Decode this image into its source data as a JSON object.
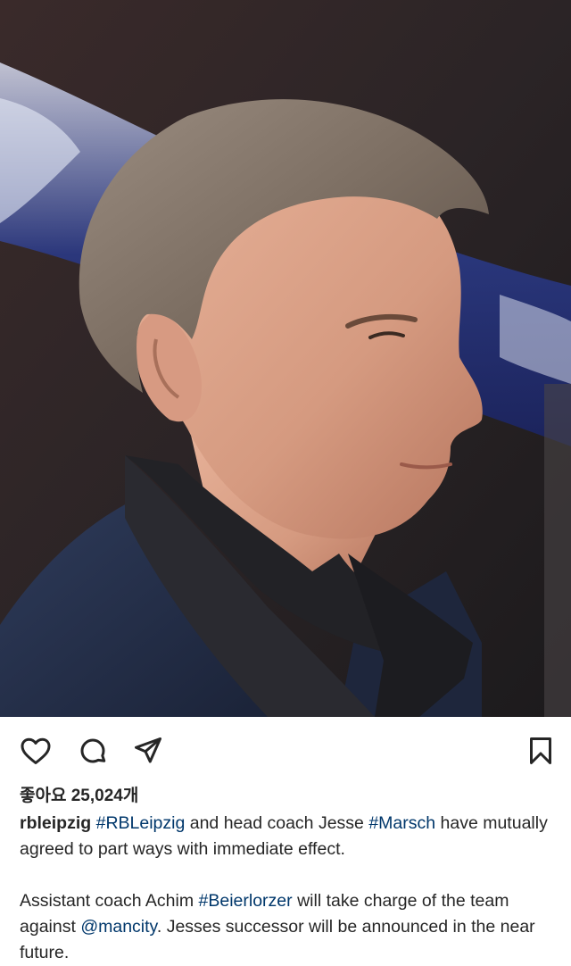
{
  "post": {
    "likes_label": "좋아요",
    "likes_count": "25,024",
    "likes_suffix": "개",
    "username": "rbleipzig",
    "caption": {
      "p1": {
        "t1": "#RBLeipzig",
        "t2": " and head coach Jesse ",
        "t3": "#Marsch",
        "t4": " have mutually agreed to part ways with immediate effect."
      },
      "p2": {
        "t1": "Assistant coach Achim ",
        "t2": "#Beierlorzer",
        "t3": " will take charge of the team against ",
        "t4": "@mancity",
        "t5": ". Jesses successor will be announced in the near future."
      }
    }
  },
  "icons": {
    "like": "heart-icon",
    "comment": "comment-bubble-icon",
    "share": "paper-plane-icon",
    "save": "bookmark-icon"
  },
  "colors": {
    "text": "#262626",
    "link": "#00376b",
    "background": "#ffffff"
  }
}
